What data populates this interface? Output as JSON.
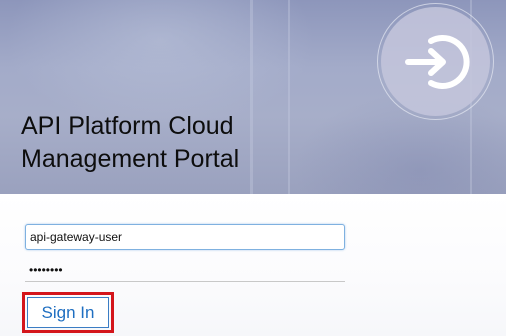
{
  "header": {
    "title_line1": "API Platform Cloud",
    "title_line2": "Management Portal",
    "logo_icon": "sign-in-arrow-icon"
  },
  "login": {
    "username_value": "api-gateway-user",
    "password_value": "••••••••",
    "sign_in_label": "Sign In"
  },
  "colors": {
    "accent": "#1f6fc1",
    "highlight": "#d4151b"
  }
}
